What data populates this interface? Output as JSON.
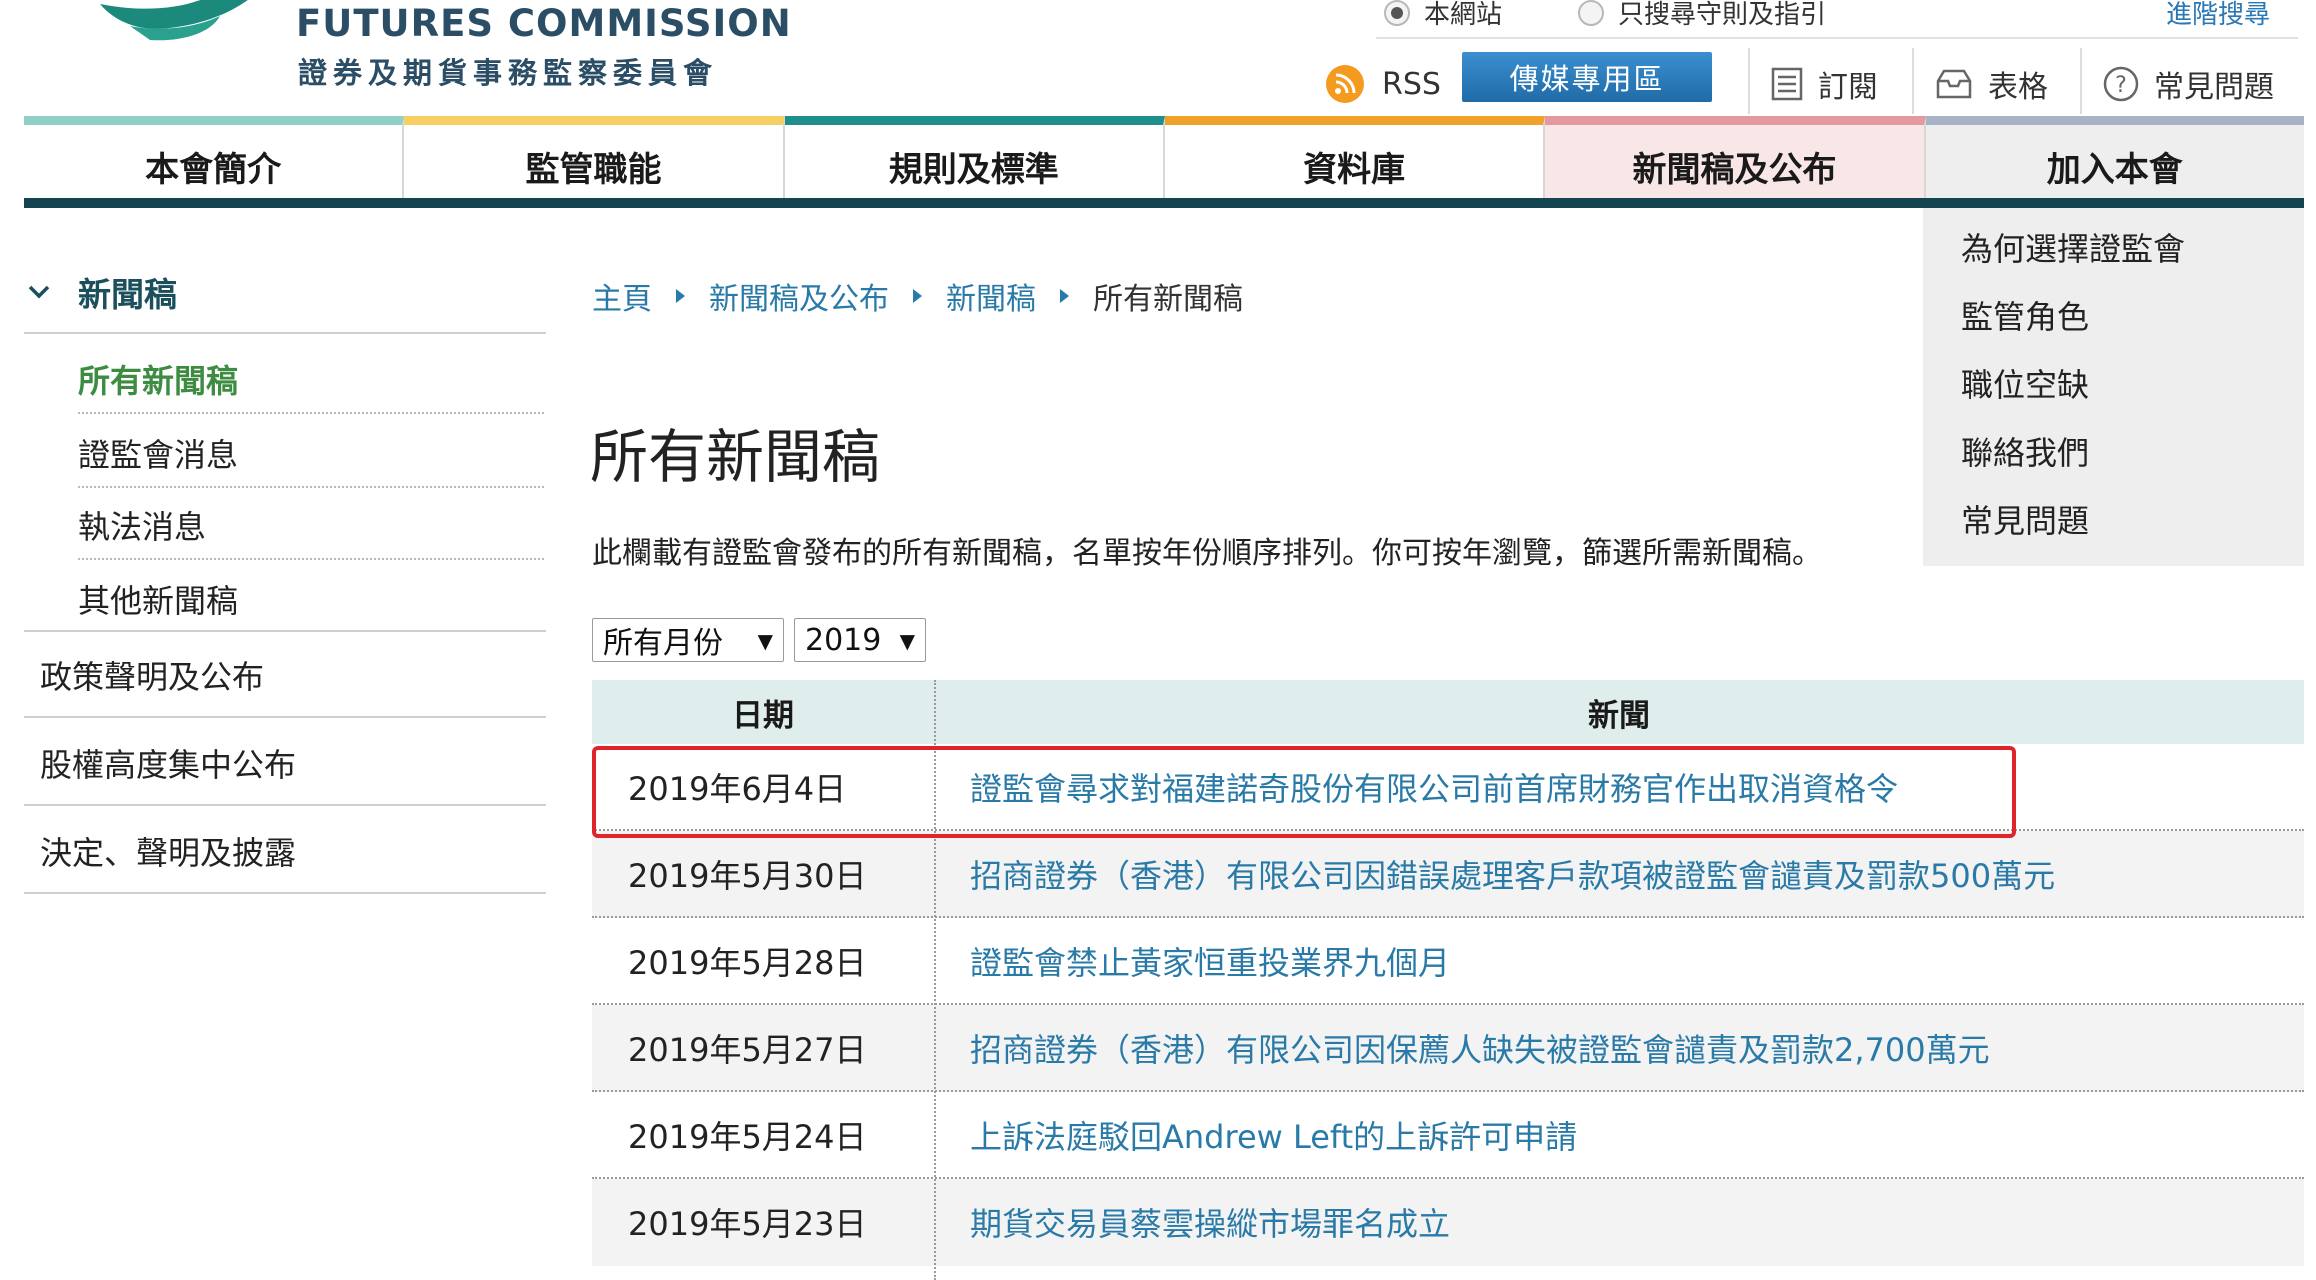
{
  "header": {
    "brand_en": "FUTURES COMMISSION",
    "brand_zh": "證券及期貨事務監察委員會",
    "search_options": [
      "本網站",
      "只搜尋守則及指引"
    ],
    "advanced_search": "進階搜尋",
    "rss_label": "RSS",
    "media_button": "傳媒專用區",
    "subscribe_label": "訂閱",
    "forms_label": "表格",
    "faq_label": "常見問題"
  },
  "nav": {
    "items": [
      {
        "label": "本會簡介",
        "accent": "#8fcfc6"
      },
      {
        "label": "監管職能",
        "accent": "#f5cf62"
      },
      {
        "label": "規則及標準",
        "accent": "#1e8f8a"
      },
      {
        "label": "資料庫",
        "accent": "#f0a12a"
      },
      {
        "label": "新聞稿及公布",
        "accent": "#e29aa0"
      },
      {
        "label": "加入本會",
        "accent": "#a8b3c7"
      }
    ]
  },
  "dropdown": {
    "items": [
      "為何選擇證監會",
      "監管角色",
      "職位空缺",
      "聯絡我們",
      "常見問題"
    ]
  },
  "sidebar": {
    "section_title": "新聞稿",
    "sub_items": [
      "所有新聞稿",
      "證監會消息",
      "執法消息",
      "其他新聞稿"
    ],
    "main_items": [
      "政策聲明及公布",
      "股權高度集中公布",
      "決定、聲明及披露"
    ]
  },
  "breadcrumb": [
    "主頁",
    "新聞稿及公布",
    "新聞稿",
    "所有新聞稿"
  ],
  "page": {
    "title": "所有新聞稿",
    "description": "此欄載有證監會發布的所有新聞稿，名單按年份順序排列。你可按年瀏覽，篩選所需新聞稿。"
  },
  "filters": {
    "month": "所有月份",
    "year": "2019"
  },
  "table": {
    "headers": [
      "日期",
      "新聞"
    ],
    "rows": [
      {
        "date": "2019年6月4日",
        "news": "證監會尋求對福建諾奇股份有限公司前首席財務官作出取消資格令"
      },
      {
        "date": "2019年5月30日",
        "news": "招商證券（香港）有限公司因錯誤處理客戶款項被證監會譴責及罰款500萬元"
      },
      {
        "date": "2019年5月28日",
        "news": "證監會禁止黃家恒重投業界九個月"
      },
      {
        "date": "2019年5月27日",
        "news": "招商證券（香港）有限公司因保薦人缺失被證監會譴責及罰款2,700萬元"
      },
      {
        "date": "2019年5月24日",
        "news": "上訴法庭駁回Andrew Left的上訴許可申請"
      },
      {
        "date": "2019年5月23日",
        "news": "期貨交易員蔡雲操縱市場罪名成立"
      }
    ]
  }
}
